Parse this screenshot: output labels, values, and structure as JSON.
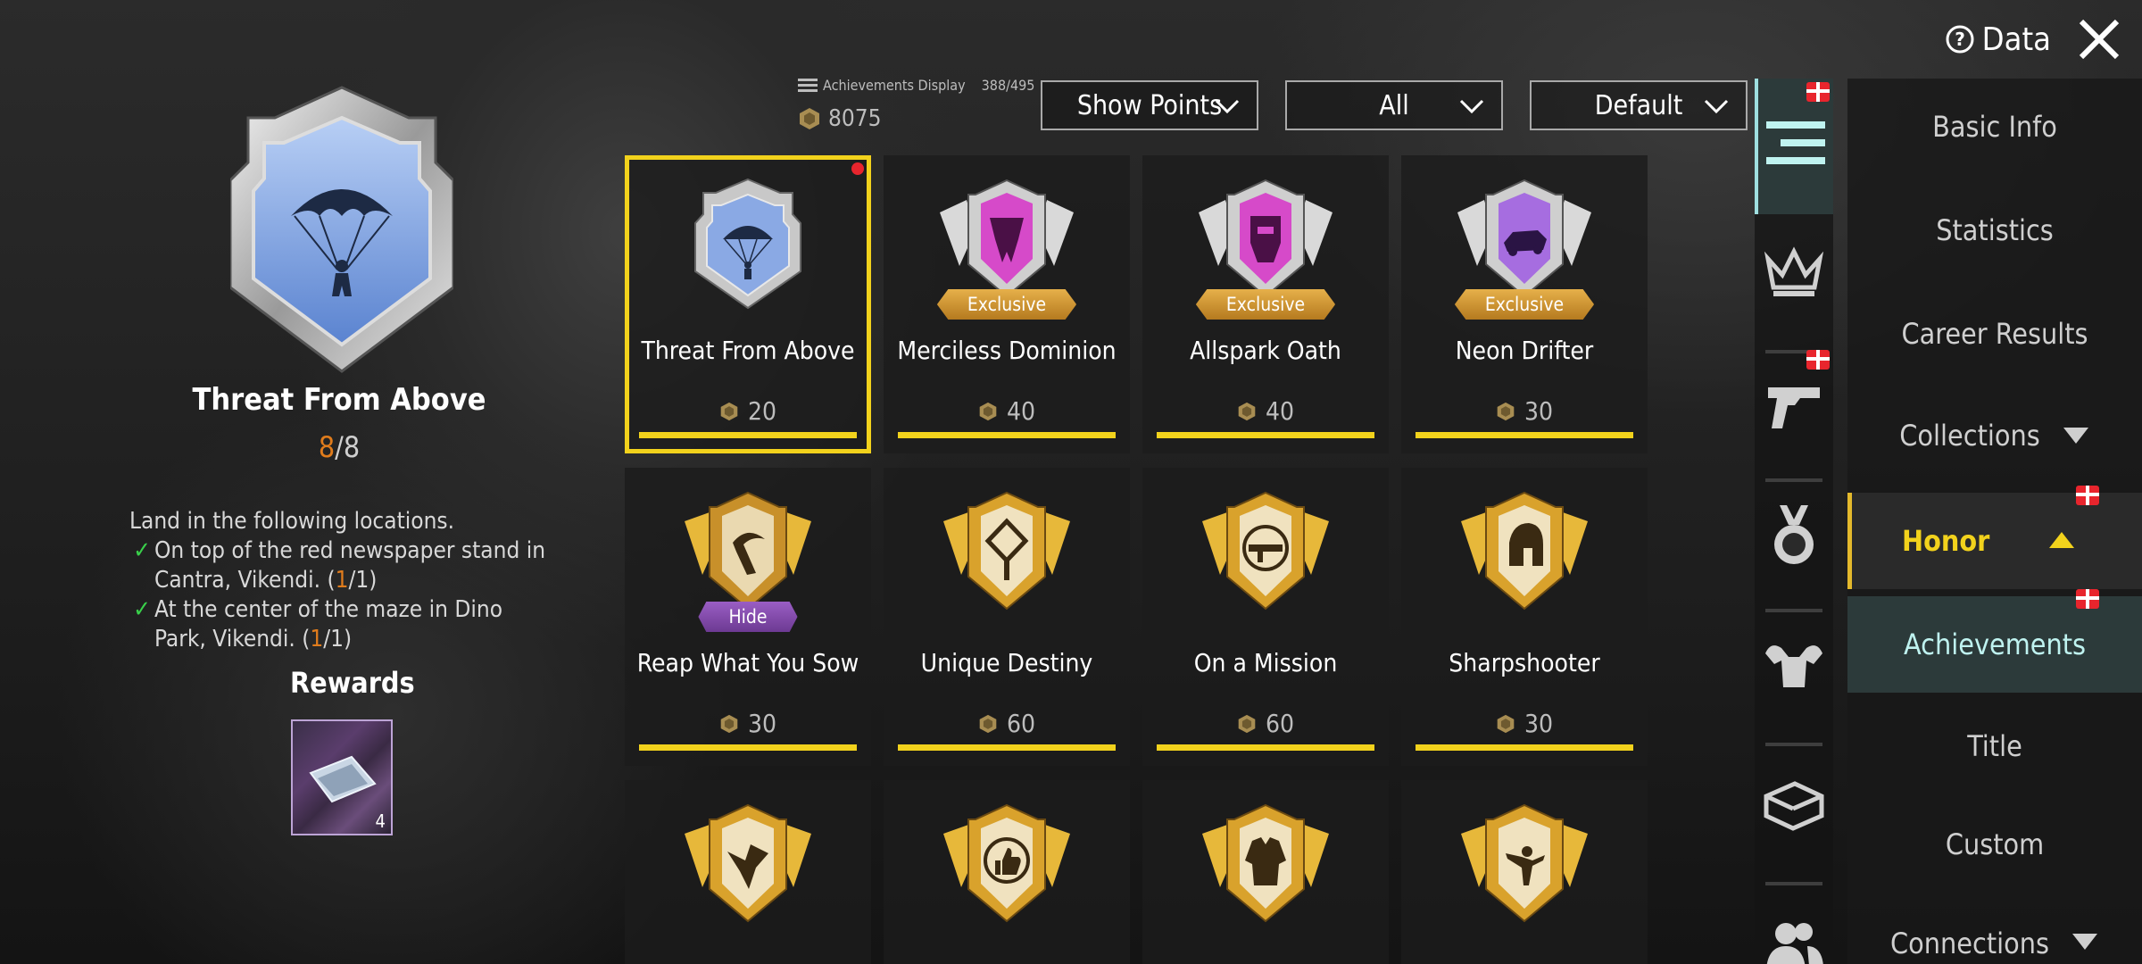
{
  "header": {
    "achievements_display_label": "Achievements Display",
    "achievements_display_count": "388/495",
    "total_points": "8075",
    "dropdowns": [
      {
        "label": "Show Points"
      },
      {
        "label": "All"
      },
      {
        "label": "Default"
      }
    ],
    "data_label": "Data"
  },
  "detail": {
    "title": "Threat From Above",
    "progress_current": "8",
    "progress_sep": "/",
    "progress_total": "8",
    "description": "Land in the following locations.",
    "requirements": [
      {
        "pre": "On top of the red newspaper stand in Cantra, Vikendi. (",
        "cur": "1",
        "post": "/1)"
      },
      {
        "pre": "At the center of the maze in Dino Park, Vikendi. (",
        "cur": "1",
        "post": "/1)"
      }
    ],
    "rewards_label": "Rewards",
    "reward_count": "4"
  },
  "achievements": [
    {
      "name": "Threat From Above",
      "points": "20",
      "tag": ""
    },
    {
      "name": "Merciless Dominion",
      "points": "40",
      "tag": "Exclusive"
    },
    {
      "name": "Allspark Oath",
      "points": "40",
      "tag": "Exclusive"
    },
    {
      "name": "Neon Drifter",
      "points": "30",
      "tag": "Exclusive"
    },
    {
      "name": "Reap What You Sow",
      "points": "30",
      "tag": "Hide"
    },
    {
      "name": "Unique Destiny",
      "points": "60",
      "tag": ""
    },
    {
      "name": "On a Mission",
      "points": "60",
      "tag": ""
    },
    {
      "name": "Sharpshooter",
      "points": "30",
      "tag": ""
    }
  ],
  "sidebar_icons": [
    "list-icon",
    "crown-icon",
    "pistol-icon",
    "medal-icon",
    "muscle-icon",
    "crate-icon",
    "friends-icon"
  ],
  "menu": [
    {
      "label": "Basic Info"
    },
    {
      "label": "Statistics"
    },
    {
      "label": "Career Results"
    },
    {
      "label": "Collections"
    },
    {
      "label": "Honor"
    },
    {
      "label": "Achievements"
    },
    {
      "label": "Title"
    },
    {
      "label": "Custom"
    },
    {
      "label": "Connections"
    }
  ],
  "colors": {
    "accent_yellow": "#f2d21c",
    "progress_orange": "#e07c1c",
    "check_green": "#39d04a",
    "selected_menu_text": "#bff3f0"
  }
}
